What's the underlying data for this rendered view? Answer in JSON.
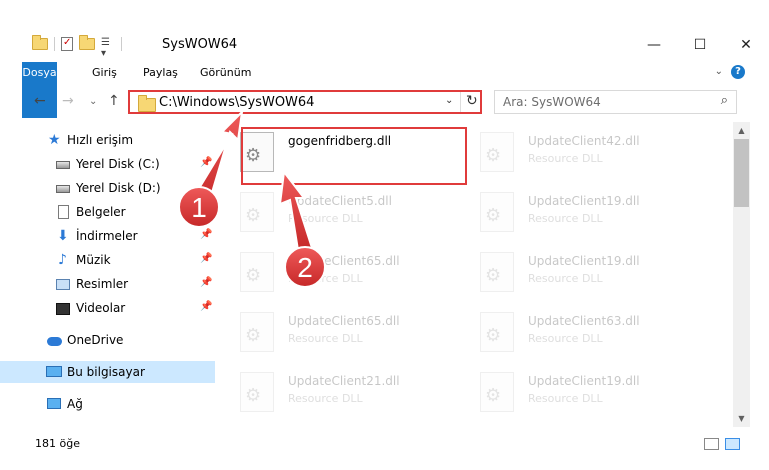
{
  "window": {
    "title": "SysWOW64",
    "minimize_glyph": "—",
    "maximize_glyph": "☐",
    "close_glyph": "✕"
  },
  "ribbon": {
    "tabs": [
      "Dosya",
      "Giriş",
      "Paylaş",
      "Görünüm"
    ],
    "accent_color": "#1979ca",
    "help_glyph": "?",
    "collapse_glyph": "⌄"
  },
  "nav": {
    "back_glyph": "←",
    "forward_glyph": "→",
    "recent_glyph": "⌄",
    "up_glyph": "↑"
  },
  "address": {
    "path": "C:\\Windows\\SysWOW64",
    "dropdown_glyph": "⌄",
    "refresh_glyph": "↻"
  },
  "search": {
    "placeholder": "Ara: SysWOW64",
    "icon": "⌕"
  },
  "sidebar": {
    "items": [
      {
        "label": "Hızlı erişim",
        "icon": "star-icon"
      },
      {
        "label": "Yerel Disk (C:)",
        "icon": "drive-icon",
        "pinned": true
      },
      {
        "label": "Yerel Disk (D:)",
        "icon": "drive-icon",
        "pinned": true
      },
      {
        "label": "Belgeler",
        "icon": "documents-icon",
        "pinned": true
      },
      {
        "label": "İndirmeler",
        "icon": "downloads-icon",
        "pinned": true
      },
      {
        "label": "Müzik",
        "icon": "music-icon",
        "pinned": true
      },
      {
        "label": "Resimler",
        "icon": "pictures-icon",
        "pinned": true
      },
      {
        "label": "Videolar",
        "icon": "videos-icon",
        "pinned": true
      },
      {
        "label": "OneDrive",
        "icon": "onedrive-icon"
      },
      {
        "label": "Bu bilgisayar",
        "icon": "this-pc-icon",
        "selected": true
      },
      {
        "label": "Ağ",
        "icon": "network-icon"
      }
    ],
    "pin_glyph": "📌",
    "music_glyph": "♪",
    "download_glyph": "⬇",
    "star_glyph": "★"
  },
  "files": [
    {
      "name": "gogenfridberg.dll",
      "type": "",
      "highlighted": true
    },
    {
      "name": "UpdateClient42.dll",
      "type": "Resource DLL"
    },
    {
      "name": "UpdateClient5.dll",
      "type": "Resource DLL"
    },
    {
      "name": "UpdateClient19.dll",
      "type": "Resource DLL"
    },
    {
      "name": "UpdateClient65.dll",
      "type": "Resource DLL"
    },
    {
      "name": "UpdateClient19.dll",
      "type": "Resource DLL"
    },
    {
      "name": "UpdateClient65.dll",
      "type": "Resource DLL"
    },
    {
      "name": "UpdateClient63.dll",
      "type": "Resource DLL"
    },
    {
      "name": "UpdateClient21.dll",
      "type": "Resource DLL"
    },
    {
      "name": "UpdateClient19.dll",
      "type": "Resource DLL"
    }
  ],
  "scrollbar": {
    "up_glyph": "▲",
    "down_glyph": "▼"
  },
  "status": {
    "item_count": "181 öğe"
  },
  "callouts": [
    {
      "number": "1"
    },
    {
      "number": "2"
    }
  ],
  "colors": {
    "callout_red": "#e03b3b",
    "selection": "#cce8ff"
  }
}
